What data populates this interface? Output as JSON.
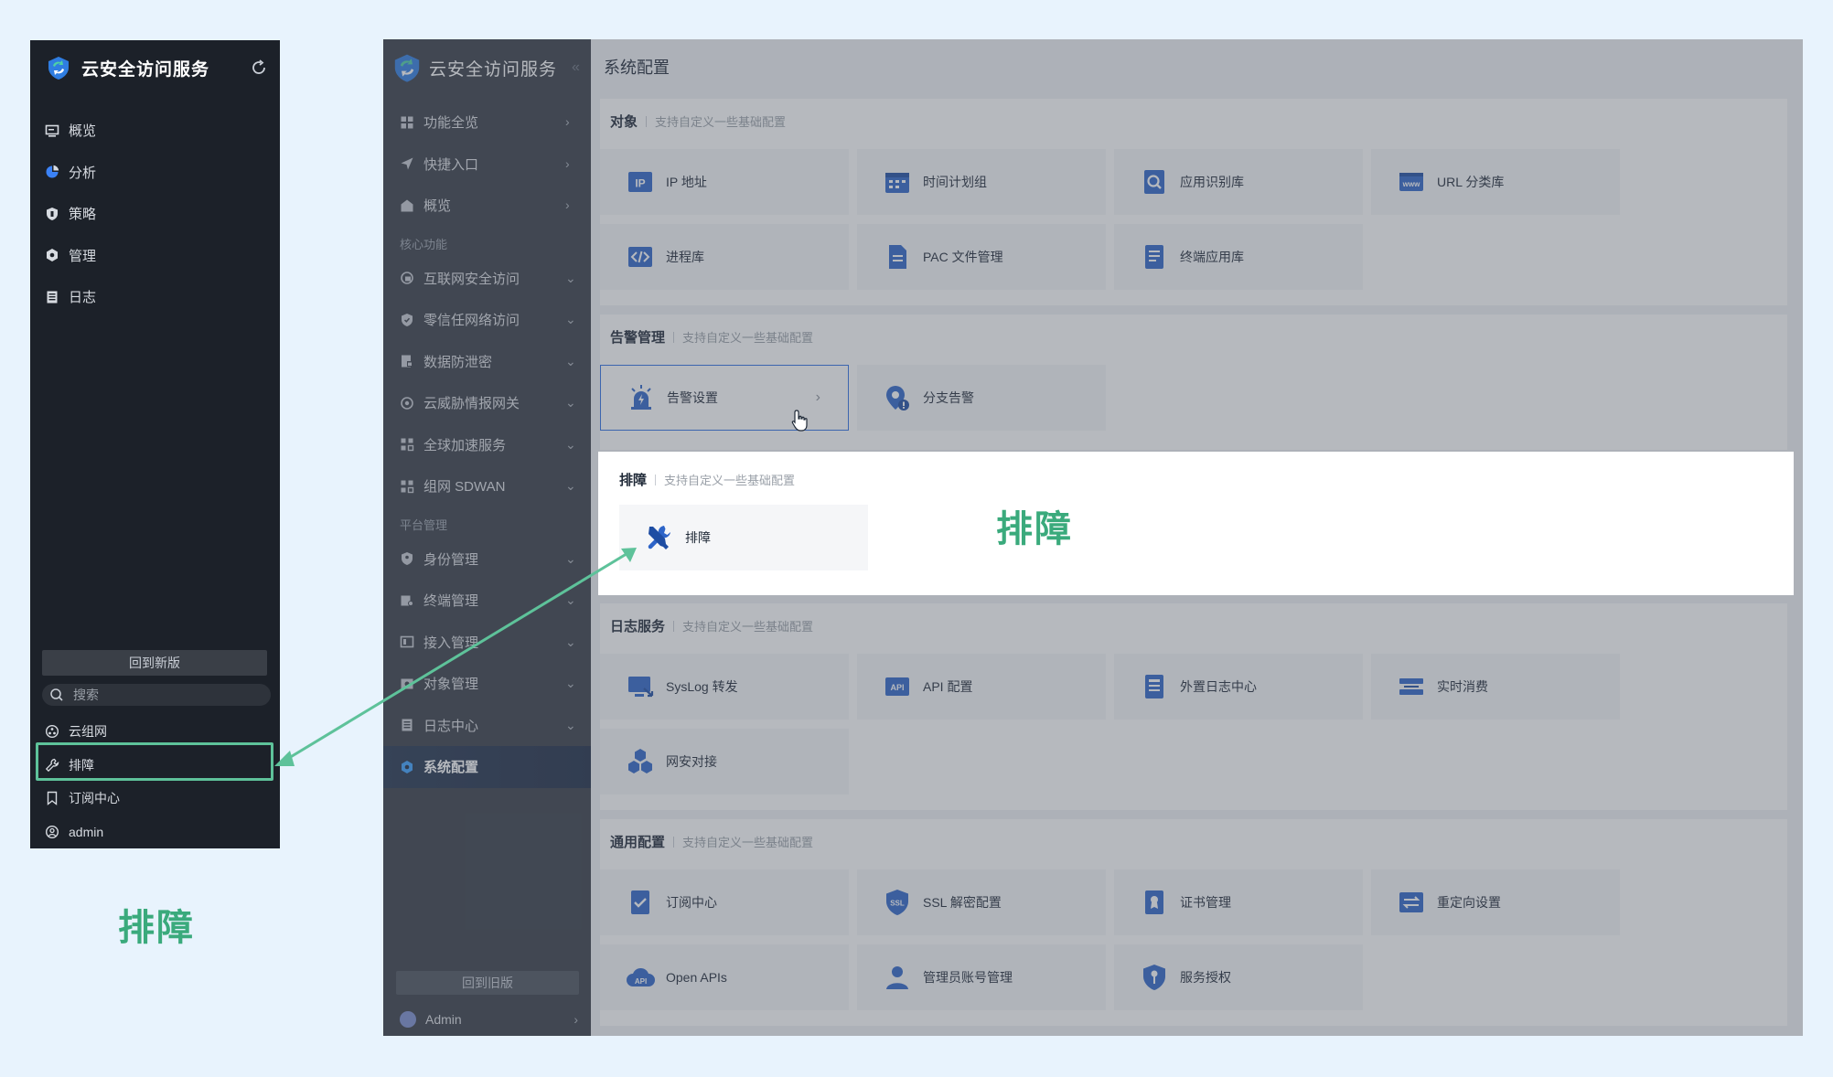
{
  "left_panel": {
    "title": "云安全访问服务",
    "nav": [
      "概览",
      "分析",
      "策略",
      "管理",
      "日志"
    ],
    "back_button": "回到新版",
    "search_placeholder": "搜索",
    "bottom": [
      "云组网",
      "排障",
      "订阅中心",
      "admin"
    ]
  },
  "captions": {
    "left": "排障",
    "right": "排障"
  },
  "main": {
    "app_title": "云安全访问服务",
    "page_title": "系统配置",
    "sidebar": {
      "top_items": [
        "功能全览",
        "快捷入口",
        "概览"
      ],
      "group_core": "核心功能",
      "core_items": [
        "互联网安全访问",
        "零信任网络访问",
        "数据防泄密",
        "云威胁情报网关",
        "全球加速服务",
        "组网 SDWAN"
      ],
      "group_platform": "平台管理",
      "platform_items": [
        "身份管理",
        "终端管理",
        "接入管理",
        "对象管理",
        "日志中心",
        "系统配置"
      ],
      "back_button": "回到旧版",
      "user": "Admin"
    },
    "sections": {
      "objects": {
        "title": "对象",
        "subtitle": "支持自定义一些基础配置",
        "cards": [
          "IP 地址",
          "时间计划组",
          "应用识别库",
          "URL 分类库",
          "进程库",
          "PAC 文件管理",
          "终端应用库"
        ]
      },
      "alerts": {
        "title": "告警管理",
        "subtitle": "支持自定义一些基础配置",
        "cards": [
          "告警设置",
          "分支告警"
        ]
      },
      "troubleshoot": {
        "title": "排障",
        "subtitle": "支持自定义一些基础配置",
        "cards": [
          "排障"
        ]
      },
      "logs": {
        "title": "日志服务",
        "subtitle": "支持自定义一些基础配置",
        "cards": [
          "SysLog 转发",
          "API 配置",
          "外置日志中心",
          "实时消费",
          "网安对接"
        ]
      },
      "general": {
        "title": "通用配置",
        "subtitle": "支持自定义一些基础配置",
        "cards": [
          "订阅中心",
          "SSL 解密配置",
          "证书管理",
          "重定向设置",
          "Open APIs",
          "管理员账号管理",
          "服务授权"
        ]
      }
    }
  },
  "colors": {
    "accent_green": "#3aaa7c",
    "highlight_border": "#5ec29a",
    "icon_blue": "#2d64c8",
    "sidebar_dark": "#363c46",
    "left_panel_dark": "#1c2129"
  }
}
